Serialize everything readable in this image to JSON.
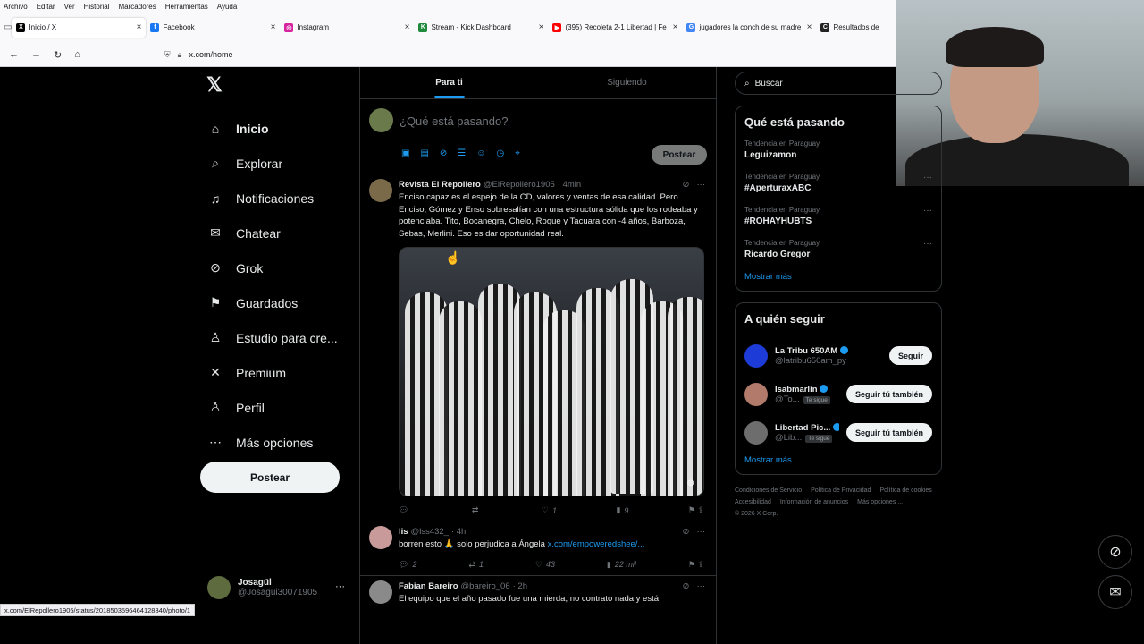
{
  "browser": {
    "menu": [
      "Archivo",
      "Editar",
      "Ver",
      "Historial",
      "Marcadores",
      "Herramientas",
      "Ayuda"
    ],
    "tabs": [
      {
        "title": "Inicio / X",
        "favicon": "X",
        "color": "#000000",
        "active": true
      },
      {
        "title": "Facebook",
        "favicon": "f",
        "color": "#1877f2",
        "active": false
      },
      {
        "title": "Instagram",
        "favicon": "◎",
        "color": "#d6249f",
        "active": false
      },
      {
        "title": "Stream - Kick Dashboard",
        "favicon": "K",
        "color": "#1f8a3b",
        "active": false
      },
      {
        "title": "(395) Recoleta 2-1 Libertad | Fe",
        "favicon": "▶",
        "color": "#ff0000",
        "active": false
      },
      {
        "title": "jugadores la conch de su madre",
        "favicon": "G",
        "color": "#4285f4",
        "active": false
      },
      {
        "title": "Resultados de",
        "favicon": "C",
        "color": "#222222",
        "active": false
      }
    ],
    "url": "x.com/home",
    "status_url": "x.com/ElRepollero1905/status/2018503596464128340/photo/1"
  },
  "nav": {
    "items": [
      {
        "label": "Inicio",
        "icon": "⌂",
        "name": "home"
      },
      {
        "label": "Explorar",
        "icon": "⌕",
        "name": "explore"
      },
      {
        "label": "Notificaciones",
        "icon": "♫",
        "name": "notifications"
      },
      {
        "label": "Chatear",
        "icon": "✉",
        "name": "chat"
      },
      {
        "label": "Grok",
        "icon": "⊘",
        "name": "grok"
      },
      {
        "label": "Guardados",
        "icon": "⚑",
        "name": "bookmarks"
      },
      {
        "label": "Estudio para cre...",
        "icon": "♙",
        "name": "creator-studio"
      },
      {
        "label": "Premium",
        "icon": "✕",
        "name": "premium"
      },
      {
        "label": "Perfil",
        "icon": "♙",
        "name": "profile"
      },
      {
        "label": "Más opciones",
        "icon": "⋯",
        "name": "more-options"
      }
    ],
    "post_label": "Postear",
    "account": {
      "display_name": "Josagül",
      "handle": "@Josagui30071905",
      "more": "···"
    }
  },
  "feed": {
    "tabs": [
      "Para ti",
      "Siguiendo"
    ],
    "composer": {
      "placeholder": "¿Qué está pasando?",
      "post_label": "Postear"
    },
    "tweets": [
      {
        "name": "Revista El Repollero",
        "handle": "@ElRepollero1905",
        "time": "· 4min",
        "text": "Enciso capaz es el espejo de la CD, valores y ventas de esa calidad. Pero Enciso, Gómez y Enso sobresalían con una estructura sólida que los rodeaba y potenciaba. Tito, Bocanegra, Chelo, Roque y Tacuara con -4 años, Barboza, Sebas, Merlini. Eso es dar oportunidad real.",
        "stats": {
          "replies": "",
          "reposts": "",
          "likes": "1",
          "views": "9"
        }
      },
      {
        "name": "lis",
        "handle": "@lss432_",
        "time": "· 4h",
        "text": "borren esto 🙏 solo perjudica a Ángela ",
        "link": "x.com/empoweredshee/...",
        "stats": {
          "replies": "2",
          "reposts": "1",
          "likes": "43",
          "views": "22 mil"
        }
      },
      {
        "name": "Fabian Bareiro",
        "handle": "@bareiro_06",
        "time": "· 2h",
        "text": "El equipo que el año pasado fue una mierda, no contrato nada y está",
        "stats": {
          "replies": "",
          "reposts": "",
          "likes": "",
          "views": ""
        }
      }
    ]
  },
  "sidebar": {
    "search_placeholder": "Buscar",
    "trending": {
      "title": "Qué está pasando",
      "items": [
        {
          "context": "Tendencia en Paraguay",
          "name": "Leguizamon"
        },
        {
          "context": "Tendencia en Paraguay",
          "name": "#AperturaxABC"
        },
        {
          "context": "Tendencia en Paraguay",
          "name": "#ROHAYHUBTS"
        },
        {
          "context": "Tendencia en Paraguay",
          "name": "Ricardo Gregor"
        }
      ],
      "show_more": "Mostrar más"
    },
    "who_to_follow": {
      "title": "A quién seguir",
      "items": [
        {
          "name": "La Tribu 650AM",
          "handle": "@latribu650am_py",
          "button": "Seguir",
          "follows_you": "",
          "color": "#1d3bd6"
        },
        {
          "name": "Isabmarlin",
          "handle": "@To...",
          "button": "Seguir tú también",
          "follows_you": "Te sigue",
          "color": "#b27a6a"
        },
        {
          "name": "Libertad Pic...",
          "handle": "@Lib...",
          "button": "Seguir tú también",
          "follows_you": "Te sigue",
          "color": "#6d6d6d"
        }
      ],
      "show_more": "Mostrar más"
    },
    "footer": [
      "Condiciones de Servicio",
      "Política de Privacidad",
      "Política de cookies",
      "Accesibilidad",
      "Información de anuncios",
      "Más opciones ...",
      "© 2026 X Corp."
    ]
  }
}
